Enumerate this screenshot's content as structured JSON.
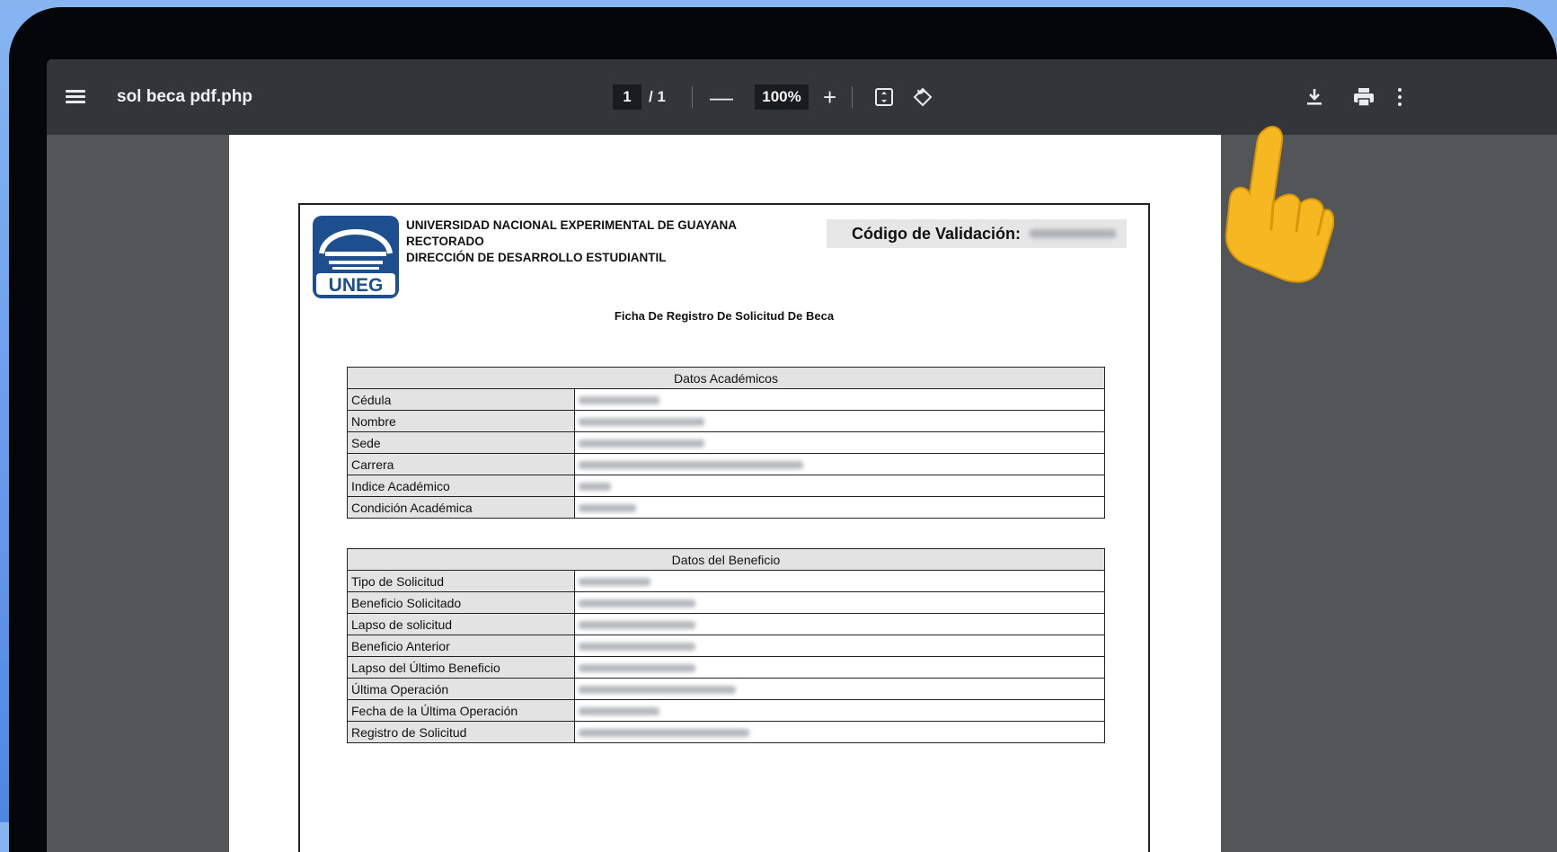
{
  "toolbar": {
    "title": "sol beca pdf.php",
    "page_current": "1",
    "page_total": "/ 1",
    "zoom_out": "—",
    "zoom": "100%",
    "zoom_in": "+"
  },
  "document": {
    "university_line1": "UNIVERSIDAD NACIONAL EXPERIMENTAL DE GUAYANA",
    "university_line2": "RECTORADO",
    "university_line3": "DIRECCIÓN DE DESARROLLO ESTUDIANTIL",
    "logo_text": "UNEG",
    "validation_label": "Código de Validación:",
    "form_title": "Ficha De Registro De Solicitud De Beca",
    "academic": {
      "header": "Datos Académicos",
      "rows": [
        "Cédula",
        "Nombre",
        "Sede",
        "Carrera",
        "Indice Académico",
        "Condición Académica"
      ]
    },
    "benefit": {
      "header": "Datos del Beneficio",
      "rows": [
        "Tipo de Solicitud",
        "Beneficio Solicitado",
        "Lapso de solicitud",
        "Beneficio Anterior",
        "Lapso del Último Beneficio",
        "Última Operación",
        "Fecha de la Última Operación",
        "Registro de Solicitud"
      ]
    }
  },
  "colors": {
    "toolbar": "#323639",
    "viewer_bg": "#525659",
    "background_gradient_top": "#86b6f2",
    "background_gradient_bottom": "#4f86e3"
  },
  "icons": [
    "menu-icon",
    "fit-page-icon",
    "rotate-icon",
    "download-icon",
    "print-icon",
    "more-icon",
    "pointing-hand-icon"
  ]
}
